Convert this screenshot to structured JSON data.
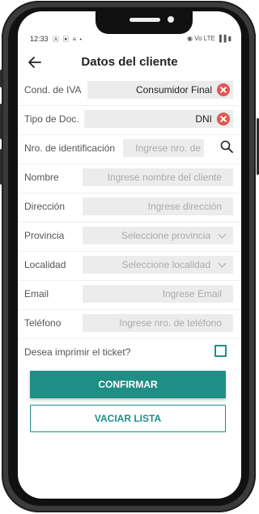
{
  "status_bar": {
    "time": "12:33",
    "left_icons": "Ⓐ ▣ ≡ •",
    "right_icons": "◉ Vo LTE ▐▐ ▮"
  },
  "header": {
    "title": "Datos del cliente",
    "back_icon": "arrow-left-icon"
  },
  "fields": {
    "cond_iva": {
      "label": "Cond. de IVA",
      "value": "Consumidor Final"
    },
    "tipo_doc": {
      "label": "Tipo de Doc.",
      "value": "DNI"
    },
    "nro_id": {
      "label": "Nro. de identificación",
      "placeholder": "Ingrese nro. de"
    },
    "nombre": {
      "label": "Nombre",
      "placeholder": "Ingrese nombre del cliente"
    },
    "direccion": {
      "label": "Dirección",
      "placeholder": "Ingrese dirección"
    },
    "provincia": {
      "label": "Provincia",
      "placeholder": "Seleccione provincia"
    },
    "localidad": {
      "label": "Localidad",
      "placeholder": "Seleccione localidad"
    },
    "email": {
      "label": "Email",
      "placeholder": "Ingrese Email"
    },
    "telefono": {
      "label": "Teléfono",
      "placeholder": "Ingrese nro. de teléfono"
    }
  },
  "print_ticket": {
    "label": "Desea imprimir el ticket?",
    "checked": false
  },
  "buttons": {
    "confirm": "CONFIRMAR",
    "clear": "VACIAR LISTA"
  },
  "colors": {
    "accent": "#1f8f86",
    "clear_red": "#e25555",
    "field_bg": "#ececec"
  }
}
